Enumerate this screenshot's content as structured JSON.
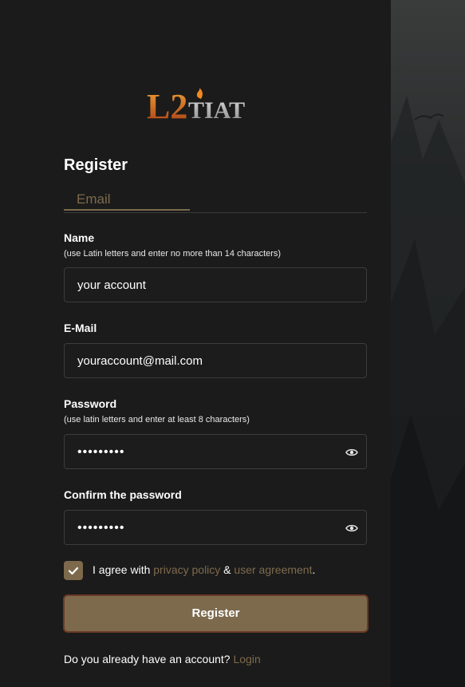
{
  "logo": {
    "text": "L2TIAT"
  },
  "form": {
    "title": "Register",
    "tab_email": "Email",
    "name_label": "Name",
    "name_hint": "(use Latin letters and enter no more than 14 characters)",
    "name_value": "your account",
    "email_label": "E-Mail",
    "email_value": "youraccount@mail.com",
    "password_label": "Password",
    "password_hint": "(use latin letters and enter at least 8 characters)",
    "password_masked": "•••••••••",
    "confirm_label": "Confirm the password",
    "confirm_masked": "•••••••••",
    "agree_prefix": "I agree with ",
    "privacy_link": "privacy policy",
    "amp": " & ",
    "agreement_link": "user agreement",
    "agree_suffix": ".",
    "register_button": "Register",
    "footer_text": "Do you already have an account? ",
    "login_link": "Login"
  },
  "colors": {
    "accent": "#7d6a4d",
    "link": "#7e6a4c",
    "background": "#1b1b1b"
  },
  "icons": {
    "password_toggle": "eye-icon",
    "checkbox": "checkmark-icon"
  }
}
